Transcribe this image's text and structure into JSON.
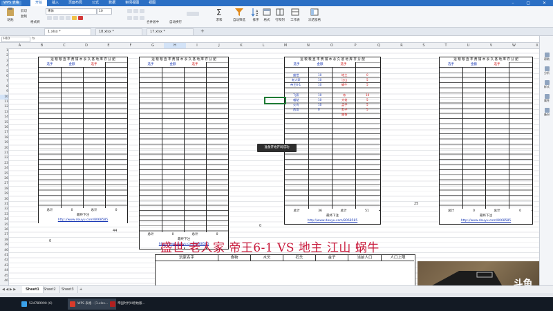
{
  "app": {
    "name": "WPS 表格",
    "menu": [
      "开始",
      "插入",
      "页面布局",
      "公式",
      "数据",
      "审阅视图",
      "视图"
    ],
    "active_menu": "开始"
  },
  "ribbon": {
    "buttons": [
      "粘贴",
      "剪切",
      "复制",
      "格式刷"
    ],
    "font_name": "宋体",
    "font_size": "10",
    "right_buttons": [
      "合并居中",
      "自动换行",
      "求和",
      "自动筛选",
      "排序",
      "格式",
      "行和列",
      "工作表",
      "冻结窗格"
    ]
  },
  "doc_tabs": [
    "1.xlsx *",
    "18.xlsx *",
    "17.xlsx *"
  ],
  "formula_bar": {
    "name_box": "H10",
    "fx": "fx"
  },
  "columns": [
    "A",
    "B",
    "C",
    "D",
    "E",
    "F",
    "G",
    "H",
    "I",
    "J",
    "K",
    "L",
    "M",
    "N",
    "O",
    "P",
    "Q",
    "R",
    "S",
    "T",
    "U",
    "V",
    "W",
    "X",
    "Y"
  ],
  "selected_column": "H",
  "rows": [
    "1",
    "2",
    "3",
    "4",
    "5",
    "6",
    "7",
    "8",
    "9",
    "10",
    "11",
    "12",
    "13",
    "14",
    "15",
    "16",
    "17",
    "18",
    "19",
    "20",
    "21",
    "22",
    "23",
    "24",
    "25",
    "26",
    "27",
    "28",
    "29",
    "30",
    "31",
    "32",
    "33",
    "34",
    "35",
    "36",
    "37",
    "38",
    "39",
    "40",
    "41",
    "42",
    "43",
    "44",
    "45",
    "46"
  ],
  "table": {
    "header": "运 粮  粮 直  丰 费  铺 木  永 久 基 地 库 存 分 配",
    "sub": [
      "选手",
      "金额",
      "选手"
    ],
    "total_label": "总计",
    "total_value": "0",
    "footer_title": "最终下注",
    "link": "http://www.douyu.com/8068585"
  },
  "table3": {
    "left_names": [
      "盛世",
      "老人家",
      "帝王6-1",
      "",
      "飞燕",
      "嘘哒",
      "火鸟",
      "西瓜"
    ],
    "left_values": [
      "10",
      "10",
      "10",
      "",
      "10",
      "10",
      "10",
      "0"
    ],
    "right_names": [
      "地主",
      "江山",
      "蜗牛",
      "",
      "帝",
      "大佬",
      "孟子",
      "丸子",
      "雷哥"
    ],
    "right_values": [
      "0",
      "5",
      "5",
      "",
      "10",
      "5",
      "5",
      "5",
      ""
    ],
    "total_left": "36",
    "total_right": "51"
  },
  "loose_values": [
    "44",
    "0",
    "25",
    "0"
  ],
  "toast": "准备开始开局成功",
  "caption": "盛世 老人家 帝王6-1 VS 地主 江山 蜗牛",
  "resource_headers": [
    "玩家名字",
    "食物",
    "木头",
    "石头",
    "金子",
    "当前人口",
    "人口上限"
  ],
  "webcam": {
    "brand": "斗鱼",
    "brand_sub": "DOUYU.COM",
    "room": "8068585"
  },
  "sidebar": [
    "帮助",
    "分析",
    "样式",
    "属性",
    "备份"
  ],
  "sheets": [
    "Sheet1",
    "Sheet2",
    "Sheet3",
    "+"
  ],
  "taskbar": [
    "524789990 (6)",
    "WPS 表格 - [1.xlsx...",
    "帝国时代III原始版..."
  ]
}
